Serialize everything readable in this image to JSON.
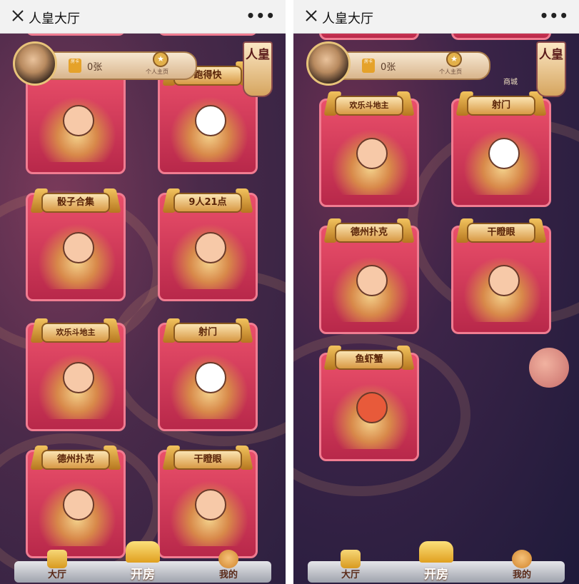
{
  "screens": [
    {
      "header": {
        "title": "人皇大厅",
        "more": "•••"
      },
      "user": {
        "room_cards": "0张",
        "personal_center": "个人主页"
      },
      "brand": "人皇",
      "tiles": [
        {
          "label": ""
        },
        {
          "label": "跑得快"
        },
        {
          "label": "骰子合集"
        },
        {
          "label": "9人21点"
        },
        {
          "label": "欢乐斗地主"
        },
        {
          "label": "射门"
        },
        {
          "label": "德州扑克"
        },
        {
          "label": "干瞪眼"
        }
      ],
      "nav": {
        "hall": "大厅",
        "create_room": "开房",
        "mine": "我的"
      }
    },
    {
      "header": {
        "title": "人皇大厅",
        "more": "•••"
      },
      "user": {
        "room_cards": "0张",
        "personal_center": "个人主页",
        "shop": "商城"
      },
      "brand": "人皇",
      "tiles": [
        {
          "label": "欢乐斗地主"
        },
        {
          "label": "射门"
        },
        {
          "label": "德州扑克"
        },
        {
          "label": "干瞪眼"
        },
        {
          "label": "鱼虾蟹"
        }
      ],
      "nav": {
        "hall": "大厅",
        "create_room": "开房",
        "mine": "我的"
      }
    }
  ]
}
